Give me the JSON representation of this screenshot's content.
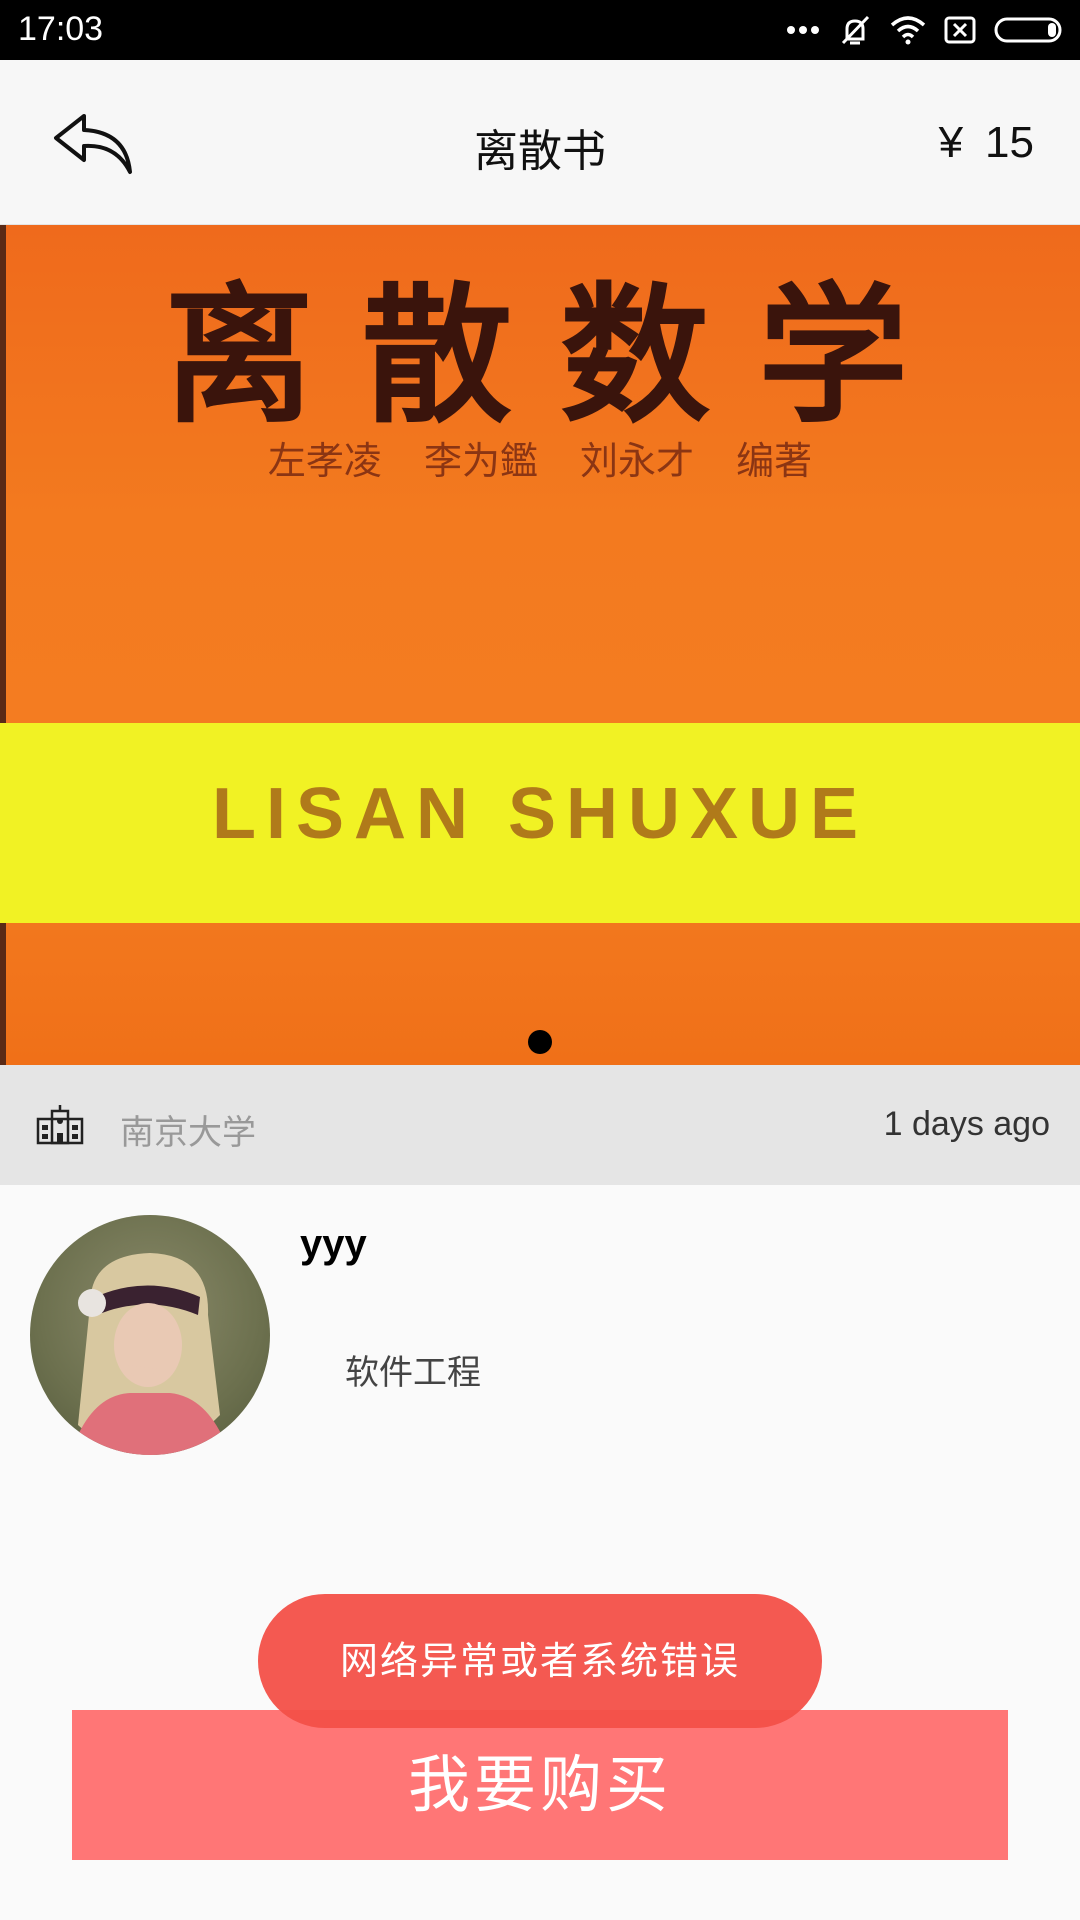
{
  "status_bar": {
    "time": "17:03"
  },
  "header": {
    "title": "离散书",
    "currency": "¥",
    "price": "15"
  },
  "cover": {
    "title": "离散数学",
    "authors": "左孝凌 李为鑑 刘永才 编著",
    "band_text": "LISAN SHUXUE"
  },
  "info": {
    "school": "南京大学",
    "posted": "1 days ago"
  },
  "seller": {
    "name": "yyy",
    "major": "软件工程"
  },
  "toast": {
    "message": "网络异常或者系统错误"
  },
  "actions": {
    "buy_label": "我要购买"
  },
  "colors": {
    "buy_button": "#ff7676",
    "toast": "#f35048",
    "cover_orange": "#f37a1f",
    "cover_band": "#f1f224"
  }
}
